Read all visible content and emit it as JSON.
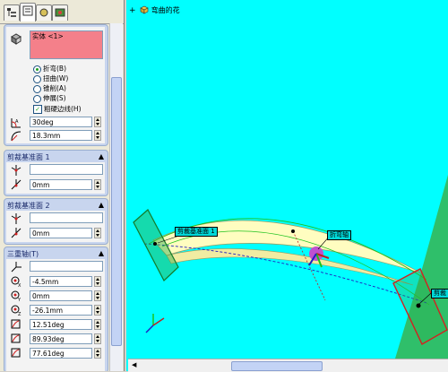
{
  "viewport": {
    "breadcrumb": "弯曲的花",
    "callouts": {
      "trim_plane_1": "剪裁基准面 1",
      "triad": "折弯轴",
      "trim_plane_2": "剪裁"
    }
  },
  "bodies_group": {
    "selected_item": "实体 <1>"
  },
  "flex_type": {
    "options": [
      "折弯(B)",
      "扭曲(W)",
      "锥削(A)",
      "伸展(S)"
    ],
    "selected": "折弯(B)",
    "hard_edges_label": "粗硬边线(H)",
    "hard_edges_checked": true,
    "angle_value": "30deg",
    "radius_value": "18.3mm"
  },
  "trim_plane_1": {
    "title": "剪裁基准面 1",
    "reference_value": "",
    "offset_value": "0mm"
  },
  "trim_plane_2": {
    "title": "剪裁基准面 2",
    "reference_value": "",
    "offset_value": "0mm"
  },
  "triad": {
    "title": "三重轴(T)",
    "reference_value": "",
    "x_value": "-4.5mm",
    "y_value": "0mm",
    "z_value": "-26.1mm",
    "rot_x_value": "12.51deg",
    "rot_y_value": "89.93deg",
    "rot_z_value": "77.61deg"
  },
  "colors": {
    "viewport_bg": "#00ffff",
    "body_fill": "#fffdc0",
    "trim_plane_1": "#1a9a3a",
    "trim_plane_2": "#d42020",
    "highlight_field": "#f4808a"
  }
}
